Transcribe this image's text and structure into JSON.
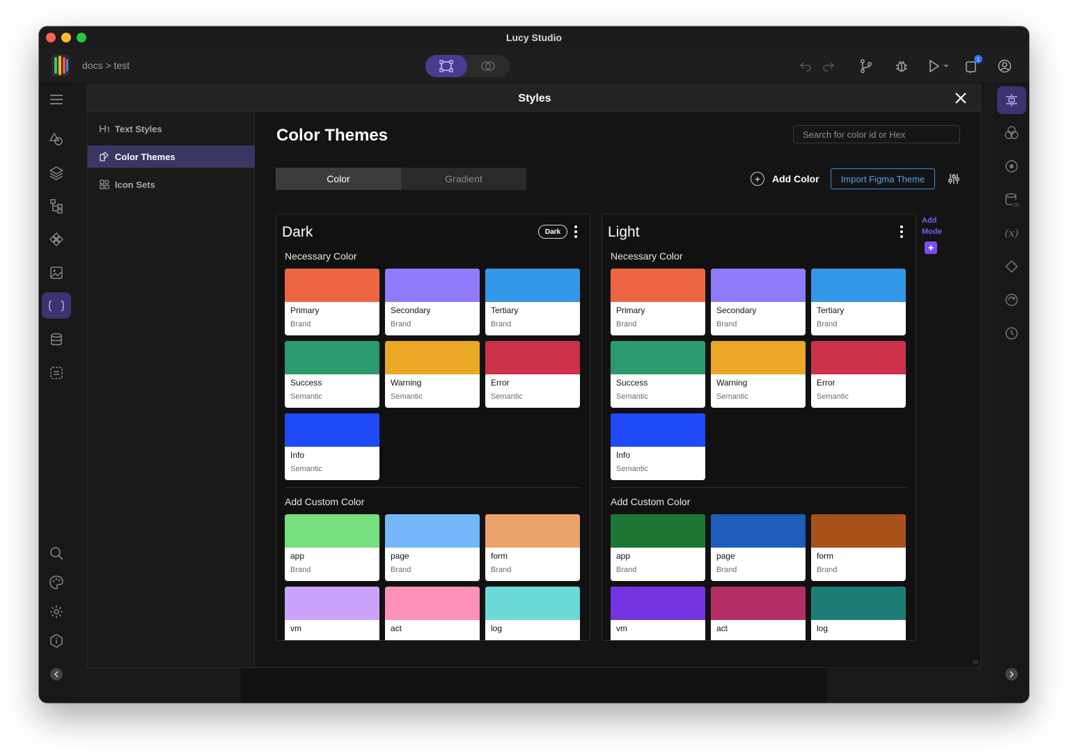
{
  "window": {
    "title": "Lucy Studio"
  },
  "toolbar": {
    "breadcrumb": "docs > test",
    "notification_count": "1"
  },
  "modal": {
    "title": "Styles",
    "sidebar": [
      {
        "label": "Text Styles",
        "icon": "heading-icon"
      },
      {
        "label": "Color Themes",
        "icon": "color-theme-icon",
        "active": true
      },
      {
        "label": "Icon Sets",
        "icon": "icon-sets-icon"
      }
    ],
    "page_title": "Color Themes",
    "search_placeholder": "Search for color id or Hex",
    "tabs": [
      {
        "label": "Color",
        "active": true
      },
      {
        "label": "Gradient"
      }
    ],
    "add_color_label": "Add Color",
    "import_label": "Import Figma Theme",
    "add_mode_label": "Add Mode"
  },
  "themes": [
    {
      "name": "Dark",
      "badge": "Dark",
      "necessary_label": "Necessary Color",
      "custom_label": "Add Custom Color",
      "necessary": [
        {
          "name": "Primary",
          "type": "Brand",
          "color": "#ee6543"
        },
        {
          "name": "Secondary",
          "type": "Brand",
          "color": "#8f7bfb"
        },
        {
          "name": "Tertiary",
          "type": "Brand",
          "color": "#3298e5"
        },
        {
          "name": "Success",
          "type": "Semantic",
          "color": "#2b9b6f"
        },
        {
          "name": "Warning",
          "type": "Semantic",
          "color": "#eaa826"
        },
        {
          "name": "Error",
          "type": "Semantic",
          "color": "#cb3149"
        },
        {
          "name": "Info",
          "type": "Semantic",
          "color": "#2049f8"
        }
      ],
      "custom": [
        {
          "name": "app",
          "type": "Brand",
          "color": "#75e07d"
        },
        {
          "name": "page",
          "type": "Brand",
          "color": "#74b8fb"
        },
        {
          "name": "form",
          "type": "Brand",
          "color": "#eba26b"
        },
        {
          "name": "vm",
          "type": "",
          "color": "#cba3fa"
        },
        {
          "name": "act",
          "type": "",
          "color": "#fc91bb"
        },
        {
          "name": "log",
          "type": "",
          "color": "#6cdad6"
        }
      ]
    },
    {
      "name": "Light",
      "badge": "",
      "necessary_label": "Necessary Color",
      "custom_label": "Add Custom Color",
      "necessary": [
        {
          "name": "Primary",
          "type": "Brand",
          "color": "#ee6543"
        },
        {
          "name": "Secondary",
          "type": "Brand",
          "color": "#8f7bfb"
        },
        {
          "name": "Tertiary",
          "type": "Brand",
          "color": "#3298e5"
        },
        {
          "name": "Success",
          "type": "Semantic",
          "color": "#2b9b6f"
        },
        {
          "name": "Warning",
          "type": "Semantic",
          "color": "#eaa826"
        },
        {
          "name": "Error",
          "type": "Semantic",
          "color": "#cb3149"
        },
        {
          "name": "Info",
          "type": "Semantic",
          "color": "#2049f8"
        }
      ],
      "custom": [
        {
          "name": "app",
          "type": "Brand",
          "color": "#1d7634"
        },
        {
          "name": "page",
          "type": "Brand",
          "color": "#1e5db9"
        },
        {
          "name": "form",
          "type": "Brand",
          "color": "#a8511a"
        },
        {
          "name": "vm",
          "type": "",
          "color": "#7433e1"
        },
        {
          "name": "act",
          "type": "",
          "color": "#b42f66"
        },
        {
          "name": "log",
          "type": "",
          "color": "#1c7d76"
        }
      ]
    }
  ],
  "colors": {
    "accent": "#4a3d8f",
    "active_nav": "#3a3764",
    "import_border": "#3a8ee6",
    "add_mode": "#7b4cf0"
  }
}
